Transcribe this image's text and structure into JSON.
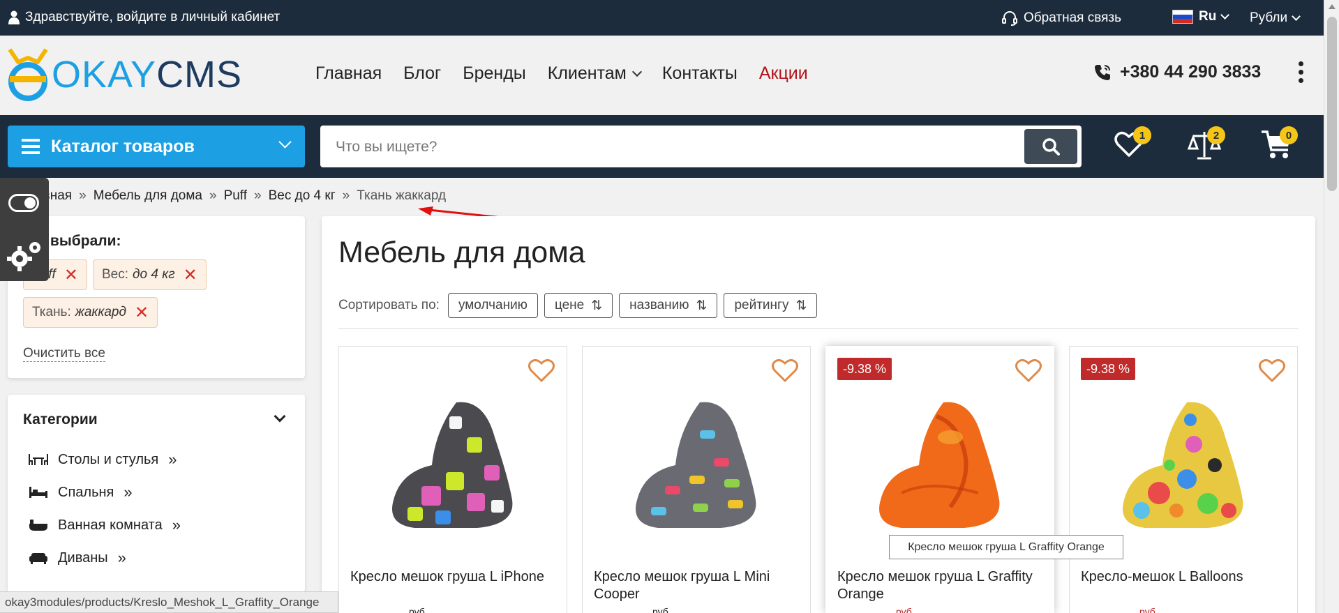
{
  "topbar": {
    "greeting": "Здравствуйте, войдите в личный кабинет",
    "feedback": "Обратная связь",
    "language": "Ru",
    "currency": "Рубли"
  },
  "header": {
    "logo_part1": "OKAY",
    "logo_part2": "CMS",
    "nav": [
      "Главная",
      "Блог",
      "Бренды",
      "Клиентам",
      "Контакты",
      "Акции"
    ],
    "phone": "+380 44 290 3833"
  },
  "searchbar": {
    "catalog_label": "Каталог товаров",
    "search_placeholder": "Что вы ищете?",
    "wishlist_count": "1",
    "compare_count": "2",
    "cart_count": "0"
  },
  "breadcrumb": [
    "лавная",
    "Мебель для дома",
    "Puff",
    "Вес до 4 кг",
    "Ткань жаккард"
  ],
  "filters": {
    "title": "Вы выбрали:",
    "chips": [
      {
        "label": "",
        "value": "Puff"
      },
      {
        "label": "Вес:",
        "value": "до 4 кг"
      },
      {
        "label": "Ткань:",
        "value": "жаккард"
      }
    ],
    "clear_all": "Очистить все"
  },
  "categories": {
    "title": "Категории",
    "items": [
      {
        "label": "Столы и стулья",
        "icon": "table-chairs-icon"
      },
      {
        "label": "Спальня",
        "icon": "bed-icon"
      },
      {
        "label": "Ванная комната",
        "icon": "bathtub-icon"
      },
      {
        "label": "Диваны",
        "icon": "sofa-icon"
      }
    ]
  },
  "main": {
    "title": "Мебель для дома",
    "sort_label": "Сортировать по:",
    "sort_options": [
      "умолчанию",
      "цене",
      "названию",
      "рейтингу"
    ]
  },
  "products": [
    {
      "name": "Кресло мешок груша L iPhone",
      "discount": "",
      "price": "руб"
    },
    {
      "name": "Кресло мешок груша L Mini Cooper",
      "discount": "",
      "price": "руб"
    },
    {
      "name": "Кресло мешок груша L Graffity Orange",
      "discount": "-9.38 %",
      "price": "руб"
    },
    {
      "name": "Кресло-мешок L Balloons",
      "discount": "-9.38 %",
      "price": "руб"
    }
  ],
  "tooltip": "Кресло мешок груша L Graffity Orange",
  "status_url": "okay3modules/products/Kreslo_Meshok_L_Graffity_Orange",
  "colors": {
    "dark": "#1d2c3c",
    "accent": "#1da0e3",
    "promo": "#b5121b",
    "badge": "#f5c518",
    "discount": "#c02a2a"
  }
}
